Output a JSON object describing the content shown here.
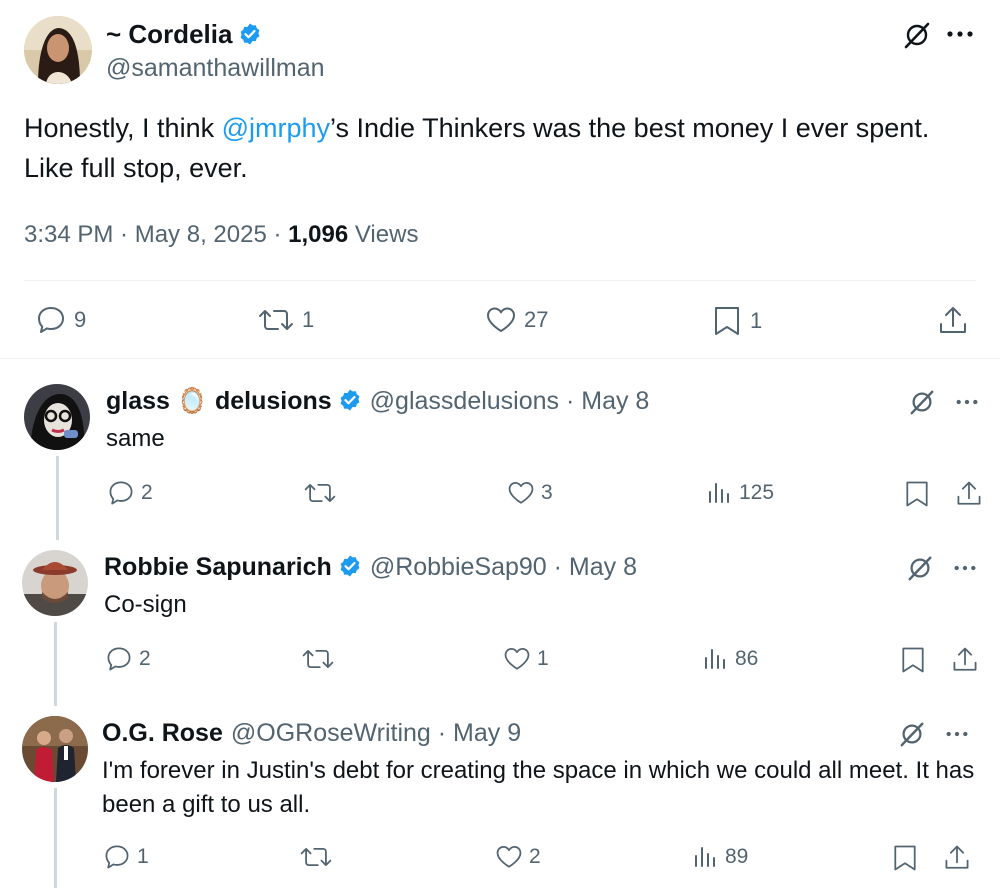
{
  "main": {
    "display_name": "~ Cordelia",
    "handle": "@samanthawillman",
    "text_before": "Honestly, I think ",
    "mention": "@jmrphy",
    "text_after": "’s Indie Thinkers was the best money I ever spent. Like full stop, ever.",
    "time": "3:34 PM · May 8, 2025 · ",
    "views_count": "1,096",
    "views_label": " Views",
    "replies": "9",
    "reposts": "1",
    "likes": "27",
    "bookmarks": "1"
  },
  "replies": [
    {
      "name_part1": "glass",
      "name_emoji": "🪞",
      "name_part2": "delusions",
      "handle_date": "@glassdelusions · May 8",
      "text": "same",
      "replies": "2",
      "reposts": "",
      "likes": "3",
      "views": "125"
    },
    {
      "name": "Robbie Sapunarich",
      "handle_date": "@RobbieSap90 · May 8",
      "text": "Co-sign",
      "replies": "2",
      "reposts": "",
      "likes": "1",
      "views": "86"
    },
    {
      "name": "O.G. Rose",
      "handle_date": "@OGRoseWriting · May 9",
      "text": "I'm forever in Justin's debt for creating the space in which we could all meet. It has been a gift to us all.",
      "replies": "1",
      "reposts": "",
      "likes": "2",
      "views": "89"
    }
  ],
  "icons": {
    "verified_color": "#1d9bf0",
    "mention_color": "#1d9bf0",
    "names": [
      "verified-badge-icon",
      "grok-icon",
      "more-icon",
      "reply-icon",
      "repost-icon",
      "like-icon",
      "bookmark-icon",
      "share-icon",
      "views-icon"
    ]
  }
}
